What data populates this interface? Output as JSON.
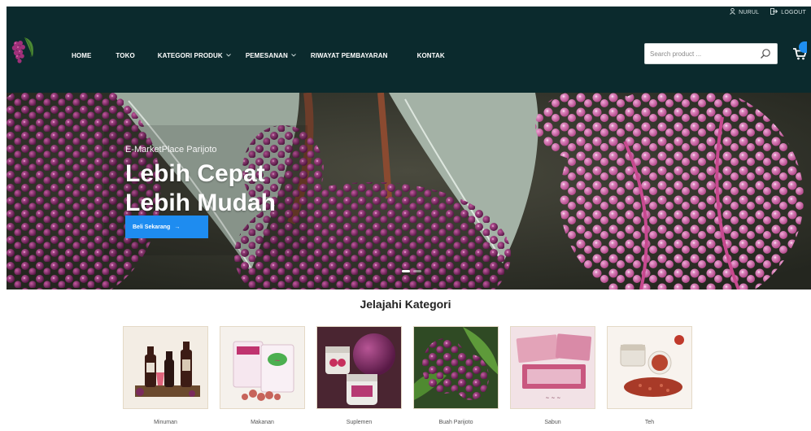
{
  "topbar": {
    "user_label": "NURUL",
    "logout_label": "LOGOUT"
  },
  "nav": {
    "items": [
      {
        "label": "HOME",
        "has_dropdown": false
      },
      {
        "label": "TOKO",
        "has_dropdown": false
      },
      {
        "label": "KATEGORI PRODUK",
        "has_dropdown": true
      },
      {
        "label": "PEMESANAN",
        "has_dropdown": true
      },
      {
        "label": "RIWAYAT PEMBAYARAN",
        "has_dropdown": false
      },
      {
        "label": "KONTAK",
        "has_dropdown": false
      }
    ]
  },
  "search": {
    "placeholder": "Search product ..."
  },
  "icons": {
    "user": "user-icon",
    "logout": "logout-icon",
    "search": "search-icon",
    "cart": "cart-icon",
    "dropdown": "chevron-down-icon",
    "arrow": "arrow-right-icon"
  },
  "hero": {
    "subtitle": "E-MarketPlace Parijoto",
    "title_line1": "Lebih Cepat",
    "title_line2": "Lebih Mudah",
    "cta_label": "Beli Sekarang",
    "cta_arrow": "→",
    "slide_count": 2,
    "active_slide": 1
  },
  "categories": {
    "title": "Jelajahi Kategori",
    "items": [
      {
        "label": "Minuman"
      },
      {
        "label": "Makanan"
      },
      {
        "label": "Suplemen"
      },
      {
        "label": "Buah Parijoto"
      },
      {
        "label": "Sabun"
      },
      {
        "label": "Teh"
      }
    ]
  },
  "colors": {
    "header_bg": "#0b2a2d",
    "accent": "#1e8cf0",
    "berry": "#8a2d6e",
    "berry_light": "#d86fb0"
  }
}
